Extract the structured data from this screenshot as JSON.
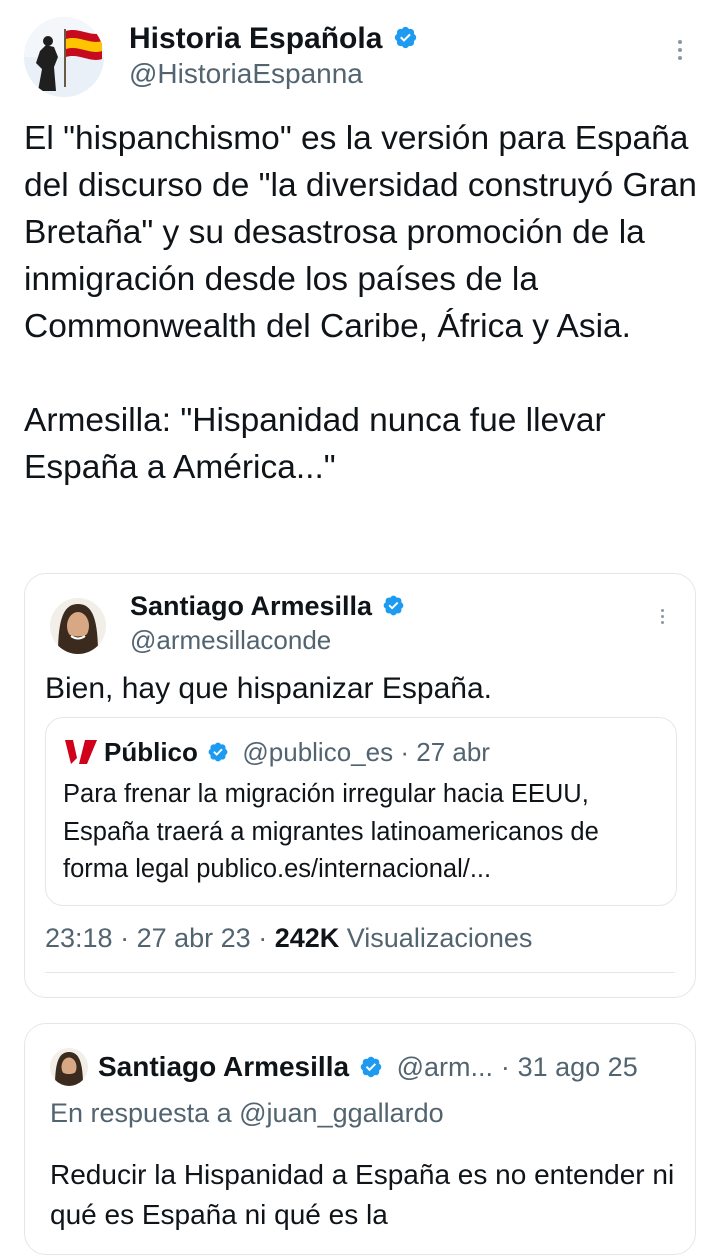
{
  "main_tweet": {
    "author_name": "Historia Española",
    "author_handle": "@HistoriaEspanna",
    "paragraphs": [
      "El \"hispanchismo\" es la versión para España del discurso de \"la diversidad construyó Gran Bretaña\" y su desastrosa promoción de la inmigración desde los países de la Commonwealth del Caribe, África y Asia.",
      "Armesilla: \"Hispanidad nunca fue llevar España a América...\""
    ]
  },
  "quoted_tweet": {
    "author_name": "Santiago Armesilla",
    "author_handle": "@armesillaconde",
    "text": "Bien, hay que hispanizar España.",
    "nested_quote": {
      "source_name": "Público",
      "source_handle": "@publico_es",
      "separator": "·",
      "date": "27 abr",
      "text": "Para frenar la migración irregular hacia EEUU, España traerá a migrantes latinoamericanos de forma legal publico.es/internacional/..."
    },
    "time": "23:18",
    "date": "27 abr 23",
    "views_count": "242K",
    "views_label": "Visualizaciones"
  },
  "reply_tweet": {
    "author_name": "Santiago Armesilla",
    "author_handle": "@arm...",
    "separator": "·",
    "date": "31 ago 25",
    "reply_to": "En respuesta a @juan_ggallardo",
    "text": "Reducir la Hispanidad a España es no entender ni qué es España ni qué es la"
  },
  "colors": {
    "verified_blue": "#1d9bf0",
    "text_primary": "#0f1419",
    "text_secondary": "#536471",
    "border": "#e1e8ed",
    "publico_red": "#d0021b"
  },
  "icons": {
    "verified": "verified-badge-icon",
    "more": "more-vertical-icon",
    "publico_logo": "publico-logo-icon"
  }
}
